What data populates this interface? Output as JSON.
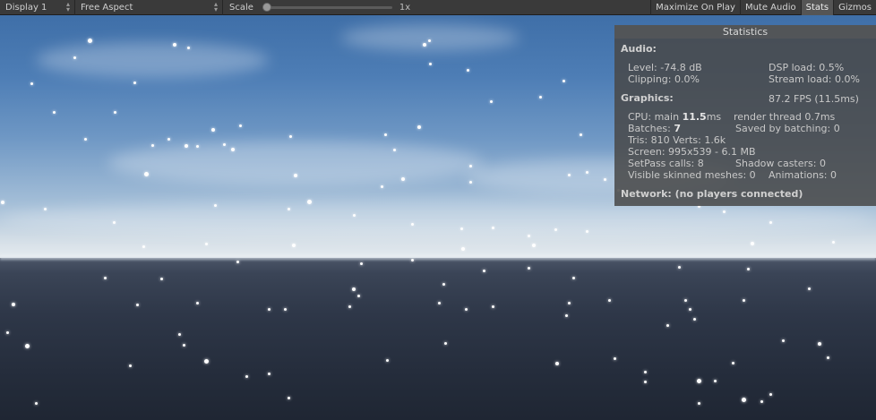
{
  "toolbar": {
    "display": "Display 1",
    "aspect": "Free Aspect",
    "scale_label": "Scale",
    "scale_value": "1x",
    "buttons": [
      "Maximize On Play",
      "Mute Audio",
      "Stats",
      "Gizmos"
    ],
    "active_button": "Stats"
  },
  "stats": {
    "title": "Statistics",
    "audio_heading": "Audio:",
    "level": "Level: -74.8 dB",
    "dsp_load": "DSP load: 0.5%",
    "clipping": "Clipping: 0.0%",
    "stream_load": "Stream load: 0.0%",
    "graphics_heading": "Graphics:",
    "fps": "87.2 FPS (11.5ms)",
    "cpu_prefix": "CPU: main ",
    "cpu_main_value": "11.5",
    "cpu_main_unit": "ms",
    "render_thread": "render thread 0.7ms",
    "batches_prefix": "Batches: ",
    "batches_value": "7",
    "saved_by_batching": "Saved by batching: 0",
    "tris_verts": "Tris: 810  Verts: 1.6k",
    "screen": "Screen: 995x539 - 6.1 MB",
    "setpass": "SetPass calls: 8",
    "shadow_casters": "Shadow casters: 0",
    "skinned_meshes": "Visible skinned meshes: 0",
    "animations": "Animations: 0",
    "network": "Network: (no players connected)"
  }
}
